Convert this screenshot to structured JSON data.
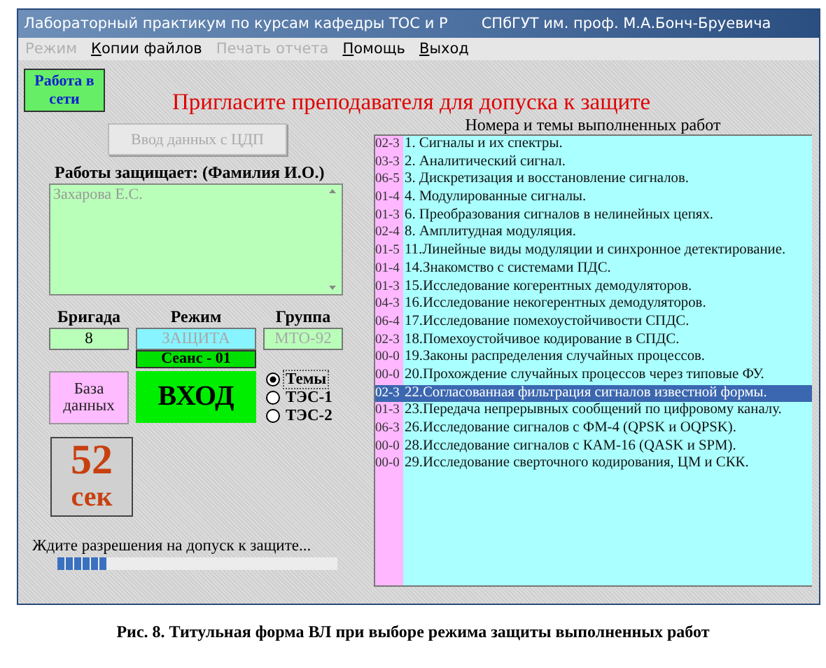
{
  "window": {
    "title": "Лабораторный практикум по курсам кафедры ТОС и Р",
    "subtitle": "СПбГУТ им. проф. М.А.Бонч-Бруевича"
  },
  "menu": [
    {
      "label": "Режим",
      "disabled": true
    },
    {
      "label": "Копии файлов",
      "disabled": false
    },
    {
      "label": "Печать отчета",
      "disabled": true
    },
    {
      "label": "Помощь",
      "disabled": false
    },
    {
      "label": "Выход",
      "disabled": false
    }
  ],
  "network_button": "Работа в сети",
  "prompt": "Пригласите преподавателя для допуска к защите",
  "import_button": {
    "label": "Ввод данных с ЦДП",
    "disabled": true
  },
  "defender": {
    "label": "Работы защищает: (Фамилия И.О.)",
    "value": "Захарова Е.С."
  },
  "fields": [
    {
      "label": "Бригада",
      "value": "8",
      "disabled": false
    },
    {
      "label": "Режим",
      "value": "ЗАЩИТА",
      "disabled": true
    },
    {
      "label": "Группа",
      "value": "МТО-92",
      "disabled": true
    }
  ],
  "session": "Сеанс - 01",
  "database_button": "База данных",
  "enter_button": "ВХОД",
  "view_options": [
    {
      "label": "Темы",
      "selected": true
    },
    {
      "label": "ТЭС-1",
      "selected": false
    },
    {
      "label": "ТЭС-2",
      "selected": false
    }
  ],
  "timer": {
    "value": "52",
    "unit": "сек"
  },
  "status": {
    "text": "Ждите разрешения на допуск к защите...",
    "level": 0.18
  },
  "works": {
    "header": "Номера и темы выполненных работ",
    "items": [
      {
        "code": "02-3",
        "title": "1. Сигналы и их спектры.",
        "selected": false
      },
      {
        "code": "03-3",
        "title": "2. Аналитический сигнал.",
        "selected": false
      },
      {
        "code": "06-5",
        "title": "3. Дискретизация и восстановление сигналов.",
        "selected": false
      },
      {
        "code": "01-4",
        "title": "4. Модулированные сигналы.",
        "selected": false
      },
      {
        "code": "01-3",
        "title": "6. Преобразования сигналов в нелинейных цепях.",
        "selected": false
      },
      {
        "code": "02-4",
        "title": "8. Амплитудная модуляция.",
        "selected": false
      },
      {
        "code": "01-5",
        "title": "11.Линейные виды модуляции и синхронное детектирование.",
        "selected": false
      },
      {
        "code": "01-4",
        "title": "14.Знакомство с системами ПДС.",
        "selected": false
      },
      {
        "code": "01-3",
        "title": "15.Исследование когерентных демодуляторов.",
        "selected": false
      },
      {
        "code": "04-3",
        "title": "16.Исследование некогерентных демодуляторов.",
        "selected": false
      },
      {
        "code": "06-4",
        "title": "17.Исследование помехоустойчивости СПДС.",
        "selected": false
      },
      {
        "code": "02-3",
        "title": "18.Помехоустойчивое кодирование в СПДС.",
        "selected": false
      },
      {
        "code": "00-0",
        "title": "19.Законы распределения случайных процессов.",
        "selected": false
      },
      {
        "code": "00-0",
        "title": "20.Прохождение случайных процессов через типовые ФУ.",
        "selected": false
      },
      {
        "code": "02-3",
        "title": "22.Согласованная фильтрация сигналов известной формы.",
        "selected": true
      },
      {
        "code": "01-3",
        "title": "23.Передача непрерывных сообщений по цифровому каналу.",
        "selected": false
      },
      {
        "code": "06-3",
        "title": "26.Исследование сигналов с ФМ-4 (QPSK и OQPSK).",
        "selected": false
      },
      {
        "code": "00-0",
        "title": "28.Исследование сигналов с КАМ-16 (QASK и SPM).",
        "selected": false
      },
      {
        "code": "00-0",
        "title": "29.Исследование сверточного кодирования, ЦМ и СКК.",
        "selected": false
      }
    ]
  },
  "caption": "Рис. 8. Титульная форма ВЛ при выборе режима защиты выполненных работ"
}
